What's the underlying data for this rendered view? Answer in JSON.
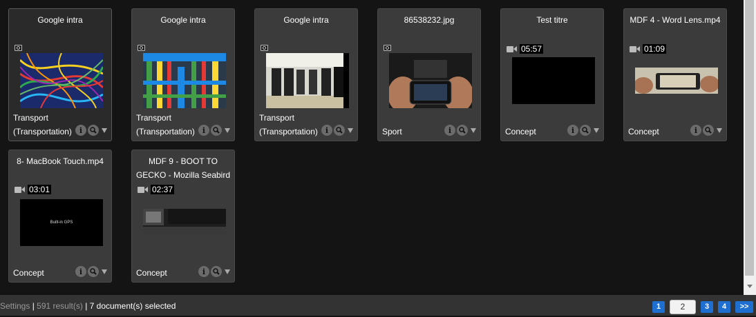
{
  "cards": [
    {
      "title": "Google intra",
      "type": "photo",
      "duration": "",
      "category": "Transport (Transportation)",
      "thumb": "colorful-cables",
      "selected": true
    },
    {
      "title": "Google intra",
      "type": "photo",
      "duration": "",
      "category": "Transport (Transportation)",
      "thumb": "colorful-pipes",
      "selected": false
    },
    {
      "title": "Google intra",
      "type": "photo",
      "duration": "",
      "category": "Transport (Transportation)",
      "thumb": "server-room",
      "selected": false
    },
    {
      "title": "86538232.jpg",
      "type": "photo",
      "duration": "",
      "category": "Sport",
      "thumb": "phone-hands-bienvenido",
      "selected": false
    },
    {
      "title": "Test titre",
      "type": "video",
      "duration": "05:57",
      "category": "Concept",
      "thumb": "black-frame",
      "selected": false
    },
    {
      "title": "MDF 4 - Word Lens.mp4",
      "type": "video",
      "duration": "01:09",
      "category": "Concept",
      "thumb": "phone-on-paper",
      "selected": false
    },
    {
      "title": "8- MacBook Touch.mp4",
      "type": "video",
      "duration": "03:01",
      "category": "Concept",
      "thumb": "built-in-gps",
      "thumb_text": "Built-in GPS",
      "selected": false
    },
    {
      "title": "MDF 9 - BOOT TO GECKO - Mozilla Seabird",
      "type": "video",
      "duration": "02:37",
      "category": "Concept",
      "thumb": "dark-devices",
      "selected": false
    }
  ],
  "actions": {
    "info": "i",
    "preview": "🔍"
  },
  "status": {
    "settings": "Settings",
    "sep1": " | ",
    "results": "591 result(s)",
    "sep2": " | ",
    "selected": "7 document(s) selected"
  },
  "pager": {
    "pages": [
      "1",
      "2",
      "3",
      "4"
    ],
    "current": "2",
    "next": ">>"
  },
  "colors": {
    "accent": "#1f6fd0",
    "card_bg": "#3b3b3b",
    "page_bg": "#141414"
  }
}
